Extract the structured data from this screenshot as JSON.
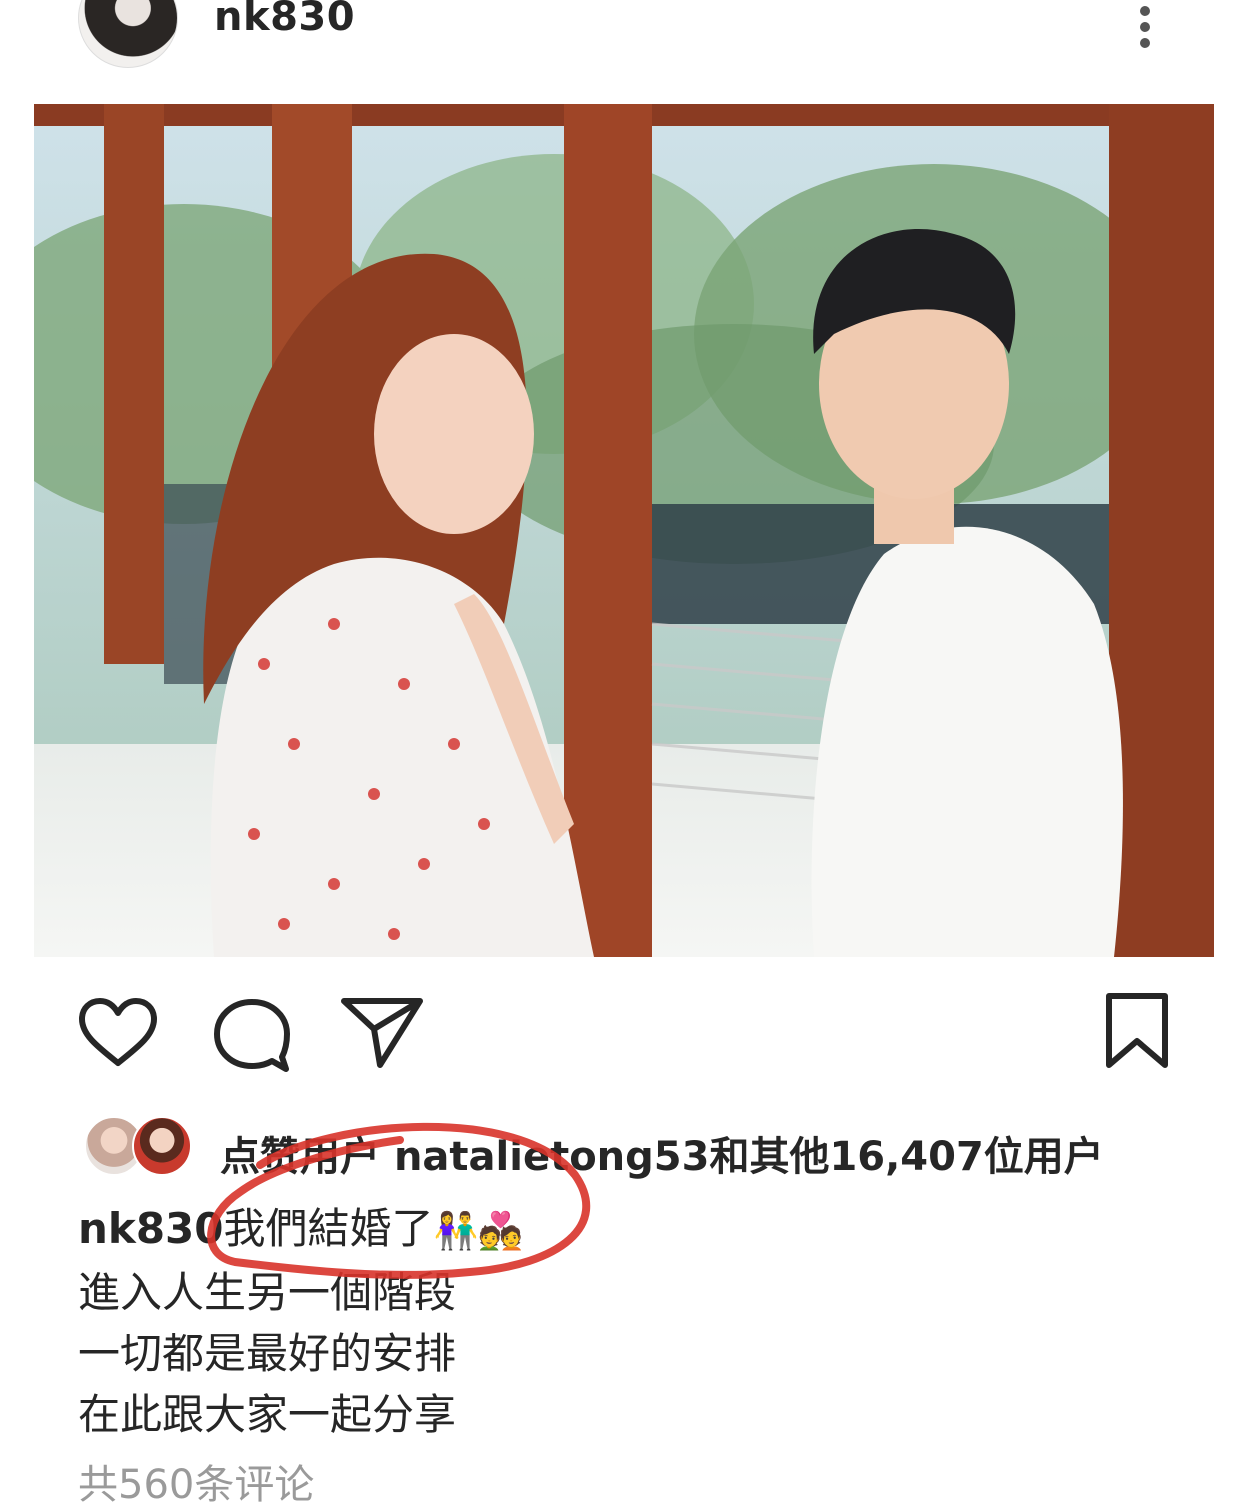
{
  "post": {
    "username": "nk830",
    "icons": {
      "avatar": "profile-avatar",
      "more": "more-vertical-icon",
      "like": "heart-icon",
      "comment": "comment-icon",
      "share": "send-icon",
      "save": "bookmark-icon"
    }
  },
  "likes": {
    "prefix": "点赞用户",
    "user": "natalietong53",
    "suffix": "和其他16,407位用户"
  },
  "caption": {
    "username": "nk830",
    "line1": "我們結婚了",
    "emoji1": "👫",
    "emoji2": "💑",
    "line2": "進入人生另一個階段",
    "line3": "一切都是最好的安排",
    "line4": "在此跟大家一起分享"
  },
  "comments": {
    "count_text": "共560条评论"
  },
  "colors": {
    "text": "#262626",
    "muted": "#9a9a9a",
    "annotation": "#d8332a"
  }
}
